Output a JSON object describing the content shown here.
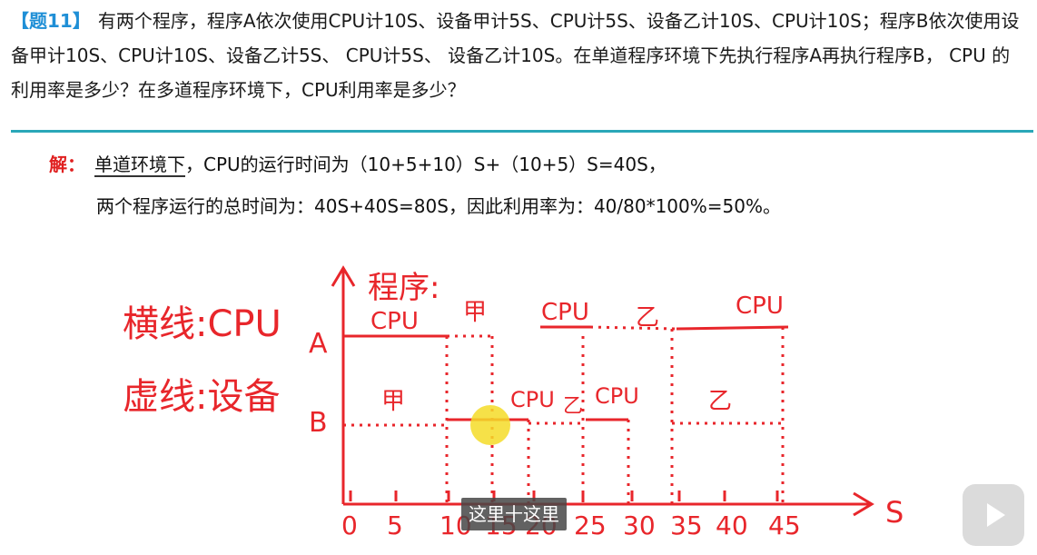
{
  "problem": {
    "tag": "【题11】",
    "text": "有两个程序，程序A依次使用CPU计10S、设备甲计5S、CPU计5S、设备乙计10S、CPU计10S；程序B依次使用设备甲计10S、CPU计10S、设备乙计5S、 CPU计5S、 设备乙计10S。在单道程序环境下先执行程序A再执行程序B， CPU 的利用率是多少？在多道程序环境下，CPU利用率是多少？"
  },
  "solution": {
    "label": "解：",
    "env_word": "单道环境下",
    "line1_rest": "，CPU的运行时间为（10+5+10）S+（10+5）S=40S，",
    "line2": "两个程序运行的总时间为：40S+40S=80S，因此利用率为：40/80*100%=50%。"
  },
  "handwriting": {
    "legend_cpu": "横线:CPU",
    "legend_device": "虚线:设备",
    "y_axis_label": "程序:",
    "row_a": "A",
    "row_b": "B",
    "x_axis_unit": "S",
    "x_ticks": [
      "0",
      "5",
      "10",
      "15",
      "20",
      "25",
      "30",
      "35",
      "40",
      "45"
    ],
    "segment_labels": [
      {
        "text": "CPU",
        "id": "a-cpu-1"
      },
      {
        "text": "甲",
        "id": "a-jia"
      },
      {
        "text": "CPU",
        "id": "a-cpu-2"
      },
      {
        "text": "乙",
        "id": "a-yi"
      },
      {
        "text": "CPU",
        "id": "a-cpu-3"
      },
      {
        "text": "甲",
        "id": "b-jia"
      },
      {
        "text": "CPU",
        "id": "b-cpu-1"
      },
      {
        "text": "乙",
        "id": "b-yi-1"
      },
      {
        "text": "CPU",
        "id": "b-cpu-2"
      },
      {
        "text": "乙",
        "id": "b-yi-2"
      }
    ]
  },
  "subtitle": "这里十这里",
  "colors": {
    "accent": "#1f8fd6",
    "rule": "#2aa7b8",
    "ink_red": "#e8262b",
    "answer_red": "#e02020"
  },
  "icons": {
    "play": "play-icon"
  }
}
